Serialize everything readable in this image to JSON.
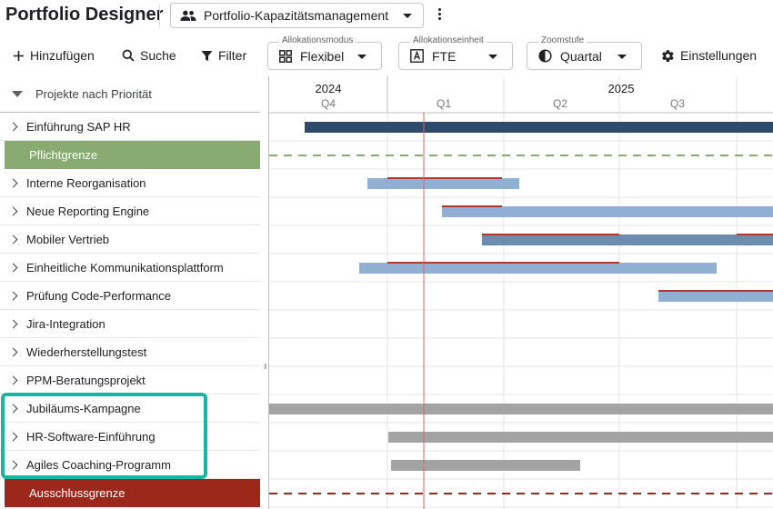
{
  "app": {
    "title": "Portfolio Designer",
    "portfolio_select": "Portfolio-Kapazitätsmanagement"
  },
  "toolbar": {
    "add_label": "Hinzufügen",
    "search_label": "Suche",
    "filter_label": "Filter",
    "alloc_mode": {
      "label": "Allokationsmodus",
      "value": "Flexibel"
    },
    "alloc_unit": {
      "label": "Allokationseinheit",
      "value": "FTE"
    },
    "zoom": {
      "label": "Zoomstufe",
      "value": "Quartal"
    },
    "settings_label": "Einstellungen"
  },
  "left": {
    "header": "Projekte nach Priorität",
    "rows": [
      {
        "label": "Einführung SAP HR",
        "kind": "project"
      },
      {
        "label": "Pflichtgrenze",
        "kind": "green-band"
      },
      {
        "label": "Interne Reorganisation",
        "kind": "project"
      },
      {
        "label": "Neue Reporting Engine",
        "kind": "project"
      },
      {
        "label": "Mobiler Vertrieb",
        "kind": "project"
      },
      {
        "label": "Einheitliche Kommunikationsplattform",
        "kind": "project"
      },
      {
        "label": "Prüfung Code-Performance",
        "kind": "project"
      },
      {
        "label": "Jira-Integration",
        "kind": "project"
      },
      {
        "label": "Wiederherstellungstest",
        "kind": "project"
      },
      {
        "label": "PPM-Beratungsprojekt",
        "kind": "project"
      },
      {
        "label": "Jubiläums-Kampagne",
        "kind": "project"
      },
      {
        "label": "HR-Software-Einführung",
        "kind": "project"
      },
      {
        "label": "Agiles Coaching-Programm",
        "kind": "project"
      },
      {
        "label": "Ausschlussgrenze",
        "kind": "red-band"
      }
    ]
  },
  "timeline": {
    "years": [
      "2024",
      "2025"
    ],
    "quarters": [
      "Q4",
      "Q1",
      "Q2",
      "Q3"
    ]
  },
  "colors": {
    "dark_blue": "#2e4a6d",
    "light_blue": "#90afd3",
    "mid_blue": "#6e8cae",
    "grey": "#a3a3a3",
    "red_line": "#c0392b",
    "green_band": "#87ab70",
    "red_band": "#9c281c",
    "highlight": "#17b6a3"
  }
}
